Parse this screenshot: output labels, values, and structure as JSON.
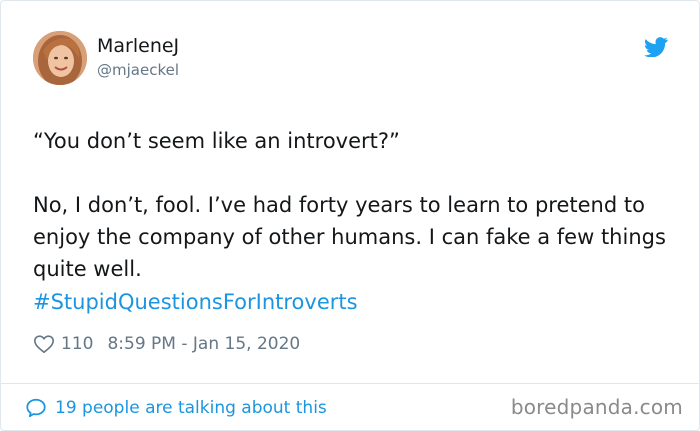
{
  "author": {
    "display_name": "MarleneJ",
    "handle": "@mjaeckel"
  },
  "tweet": {
    "text": "“You don’t seem like an introvert?”\n\nNo, I don’t, fool. I’ve had forty years to learn to pretend to enjoy the company of other humans. I can fake a few things quite well.",
    "hashtag": "#StupidQuestionsForIntroverts",
    "like_count": "110",
    "timestamp": "8:59 PM - Jan 15, 2020"
  },
  "footer": {
    "talking_label": "19 people are talking about this",
    "watermark": "boredpanda.com"
  },
  "icons": {
    "brand": "twitter-bird-icon",
    "like": "heart-icon",
    "reply": "speech-bubble-icon"
  },
  "colors": {
    "link_blue": "#1b95e0",
    "twitter_blue": "#1da1f2",
    "muted_gray": "#657786",
    "text_dark": "#14171a"
  }
}
